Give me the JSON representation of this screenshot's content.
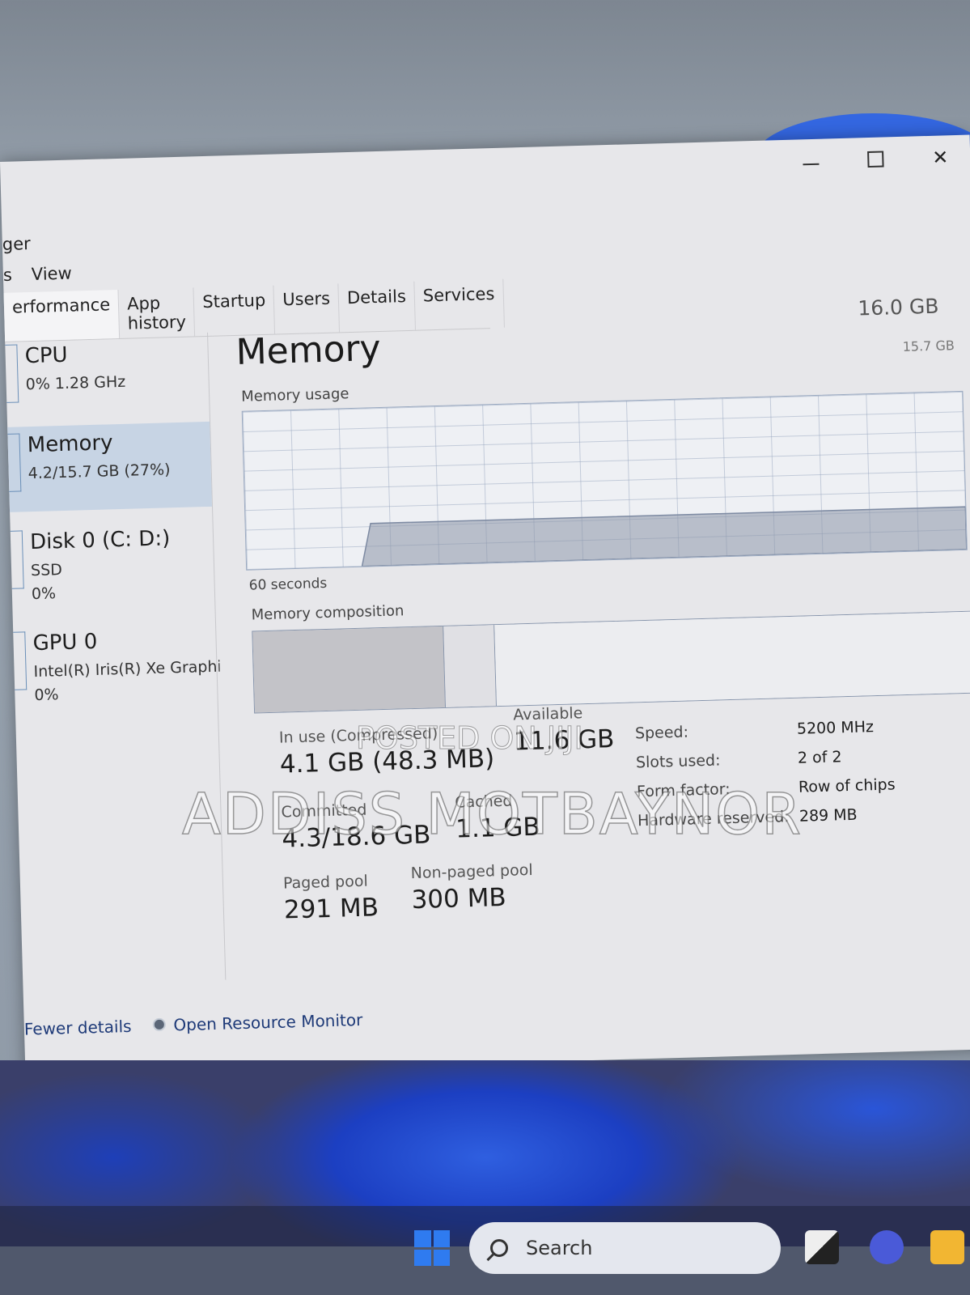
{
  "window": {
    "title_fragment": "ger",
    "menu": [
      "s",
      "View"
    ],
    "tabs": [
      "erformance",
      "App history",
      "Startup",
      "Users",
      "Details",
      "Services"
    ],
    "controls": {
      "minimize": "minimize",
      "maximize": "maximize",
      "close": "✕"
    }
  },
  "sidebar": {
    "items": [
      {
        "title": "CPU",
        "line1": "0%  1.28 GHz",
        "line2": ""
      },
      {
        "title": "Memory",
        "line1": "4.2/15.7 GB (27%)",
        "line2": ""
      },
      {
        "title": "Disk 0 (C: D:)",
        "line1": "SSD",
        "line2": "0%"
      },
      {
        "title": "GPU 0",
        "line1": "Intel(R) Iris(R) Xe Graphi",
        "line2": "0%"
      }
    ]
  },
  "main": {
    "title": "Memory",
    "total": "16.0 GB",
    "usage_label": "Memory usage",
    "usage_max": "15.7 GB",
    "time_label": "60 seconds",
    "composition_label": "Memory composition",
    "usage_fraction": 0.27,
    "composition": {
      "in_use": 0.265,
      "modified": 0.07,
      "standby_free": 0.665
    },
    "stats": {
      "in_use_label": "In use (Compressed)",
      "in_use_value": "4.1 GB (48.3 MB)",
      "available_label": "Available",
      "available_value": "11.6 GB",
      "committed_label": "Committed",
      "committed_value": "4.3/18.6 GB",
      "cached_label": "Cached",
      "cached_value": "1.1 GB",
      "paged_label": "Paged pool",
      "paged_value": "291 MB",
      "nonpaged_label": "Non-paged pool",
      "nonpaged_value": "300 MB"
    },
    "specs": [
      {
        "key": "Speed:",
        "value": "5200 MHz"
      },
      {
        "key": "Slots used:",
        "value": "2 of 2"
      },
      {
        "key": "Form factor:",
        "value": "Row of chips"
      },
      {
        "key": "Hardware reserved:",
        "value": "289 MB"
      }
    ]
  },
  "footer": {
    "fewer_details": "Fewer details",
    "resource_monitor": "Open Resource Monitor"
  },
  "taskbar": {
    "search_label": "Search"
  },
  "watermark": {
    "line1": "POSTED ON JIJI",
    "line2": "ADDISS MOTBAYNOR"
  }
}
